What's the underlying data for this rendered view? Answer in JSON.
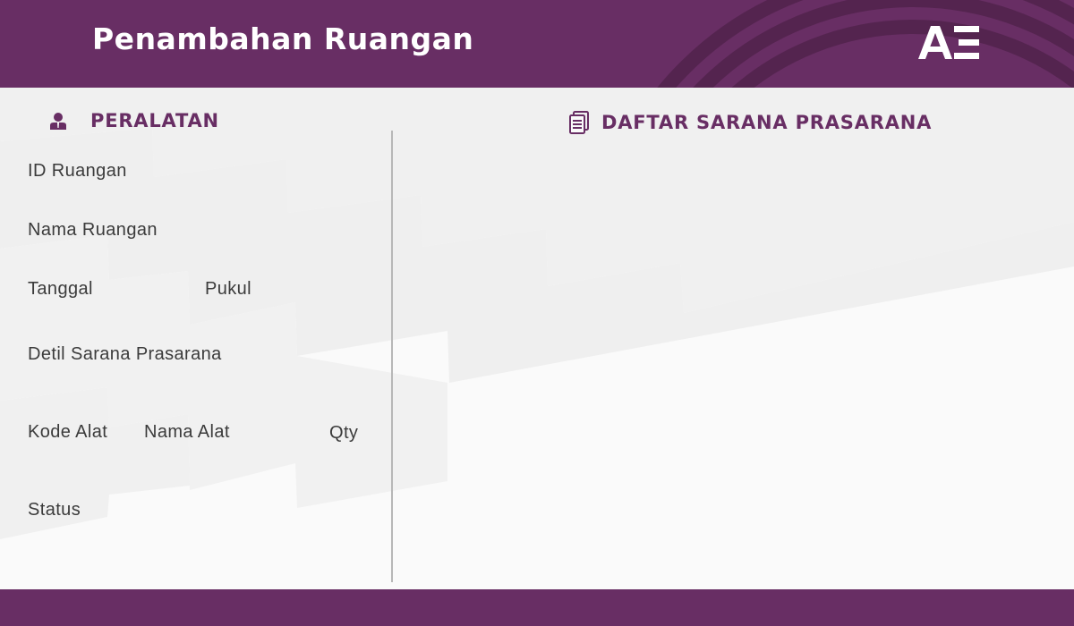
{
  "header": {
    "title": "Penambahan Ruangan",
    "logo": "AE",
    "background": "#682e64"
  },
  "left_panel": {
    "title": "PERALATAN",
    "icon": "user-icon",
    "labels": {
      "room_id": "ID Ruangan",
      "room_name": "Nama Ruangan",
      "date": "Tanggal",
      "time": "Pukul",
      "facility_details": "Detil Sarana Prasarana",
      "tool_code": "Kode Alat",
      "tool_name": "Nama Alat",
      "qty": "Qty",
      "status": "Status"
    }
  },
  "right_panel": {
    "title": "DAFTAR SARANA PRASARANA",
    "icon": "document-list-icon"
  },
  "colors": {
    "accent": "#682e64",
    "text": "#3b3b3b",
    "divider": "#b7b7b7"
  }
}
